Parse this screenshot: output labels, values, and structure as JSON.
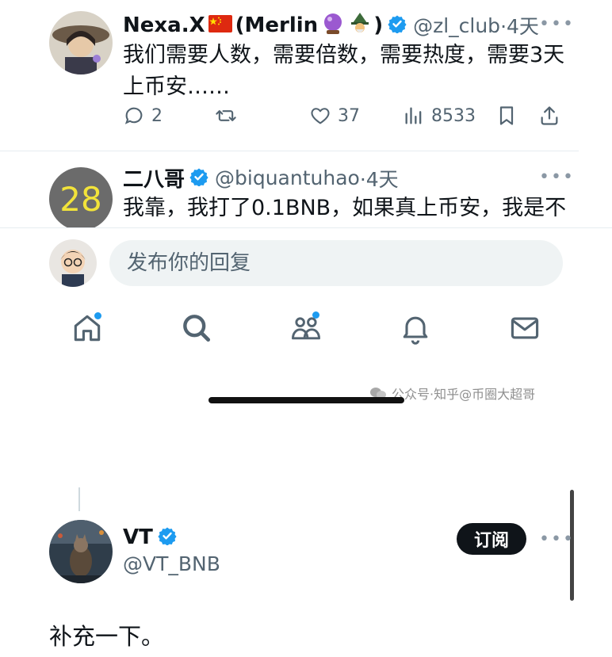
{
  "tweets": [
    {
      "name": "Nexa.X",
      "name_suffix_open": "(Merlin",
      "name_suffix_close": ")",
      "handle": "@zl_club",
      "time": "·4天",
      "text_line1": "我们需要人数，需要倍数，需要热度，需要3天",
      "text_line2": "上币安……",
      "replies": "2",
      "likes": "37",
      "views": "8533"
    },
    {
      "name": "二八哥",
      "handle": "@biquantuhao",
      "time": "·4天",
      "avatar_text": "28",
      "text_line1": "我靠，我打了0.1BNB，如果真上币安，我是不"
    }
  ],
  "reply": {
    "placeholder": "发布你的回复"
  },
  "watermark": "公众号·知乎@币圈大超哥",
  "vt_tweet": {
    "name": "VT",
    "handle": "@VT_BNB",
    "subscribe_label": "订阅",
    "text": "补充一下。"
  },
  "colors": {
    "verified": "#1d9bf0",
    "text_primary": "#0f1419",
    "text_secondary": "#536471",
    "nav_dot": "#1d9bf0"
  },
  "icons": [
    "comment-icon",
    "retweet-icon",
    "like-icon",
    "views-icon",
    "bookmark-icon",
    "share-icon",
    "home-icon",
    "search-icon",
    "communities-icon",
    "notifications-icon",
    "messages-icon",
    "more-icon",
    "verified-icon"
  ]
}
